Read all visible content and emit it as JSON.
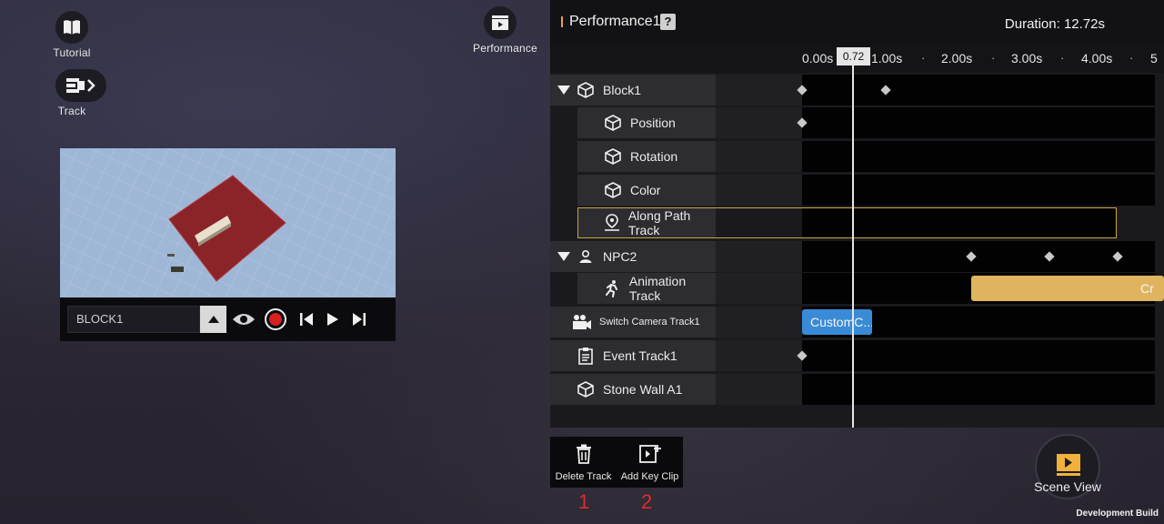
{
  "hud": {
    "tutorial_label": "Tutorial",
    "track_label": "Track",
    "performance_label": "Performance"
  },
  "preview": {
    "object_name": "BLOCK1"
  },
  "panel": {
    "title": "Performance1",
    "help_symbol": "?",
    "duration": "Duration: 12.72s",
    "playhead_value": "0.72",
    "ruler_ticks": [
      "0.00s",
      "1.00s",
      "2.00s",
      "3.00s",
      "4.00s",
      "5"
    ],
    "tracks": [
      {
        "label": "Block1",
        "icon": "cube-icon"
      },
      {
        "label": "Position",
        "icon": "cube-icon"
      },
      {
        "label": "Rotation",
        "icon": "cube-icon"
      },
      {
        "label": "Color",
        "icon": "cube-icon"
      },
      {
        "label": "Along Path Track",
        "icon": "path-pin-icon"
      },
      {
        "label": "NPC2",
        "icon": "person-icon"
      },
      {
        "label": "Animation Track",
        "icon": "running-person-icon"
      },
      {
        "label": "Switch Camera Track1",
        "icon": "camera-icon"
      },
      {
        "label": "Event Track1",
        "icon": "clipboard-icon"
      },
      {
        "label": "Stone Wall A1",
        "icon": "cube-icon"
      }
    ],
    "clips": {
      "animation_clip": "Cr",
      "camera_clip": "CustomC..."
    }
  },
  "toolbar": {
    "delete_label": "Delete Track",
    "add_key_label": "Add Key Clip"
  },
  "annotations": {
    "num1": "1",
    "num2": "2"
  },
  "scene_view_label": "Scene View",
  "dev_build": "Development Build",
  "colors": {
    "accent_title": "#e8a23b",
    "clip_animation": "#e0b45e",
    "clip_camera": "#3a8bd6",
    "annotation_red": "#e42b2b"
  }
}
